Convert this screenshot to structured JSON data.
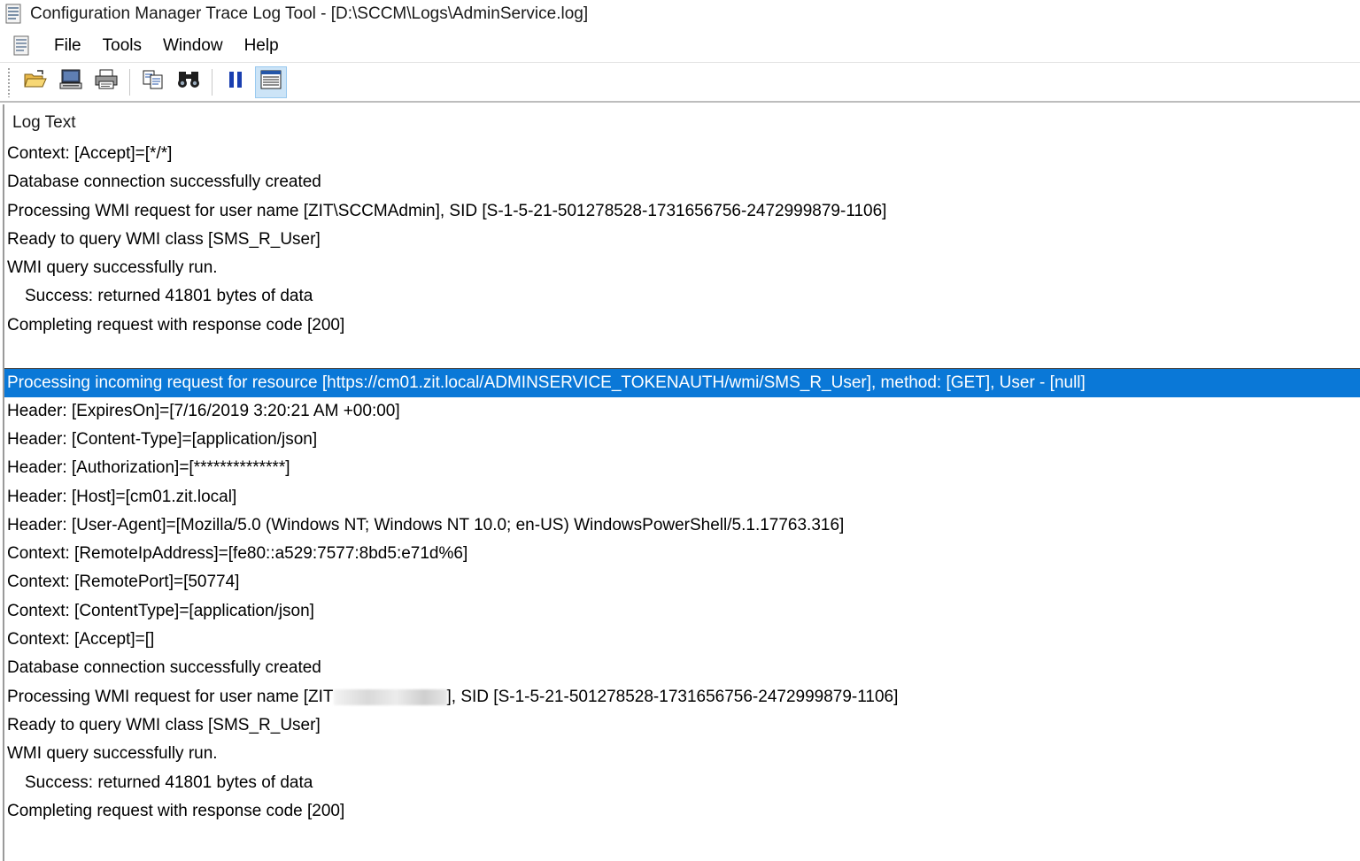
{
  "window": {
    "title": "Configuration Manager Trace Log Tool - [D:\\SCCM\\Logs\\AdminService.log]",
    "app_icon": "log-document-icon"
  },
  "menu": {
    "doc_icon": "document-icon",
    "items": [
      {
        "label": "File"
      },
      {
        "label": "Tools"
      },
      {
        "label": "Window"
      },
      {
        "label": "Help"
      }
    ]
  },
  "toolbar": {
    "buttons": [
      {
        "icon": "open-folder-icon"
      },
      {
        "icon": "computer-icon"
      },
      {
        "icon": "print-icon"
      },
      {
        "icon": "copy-icon"
      },
      {
        "icon": "find-binoculars-icon"
      },
      {
        "icon": "pause-icon"
      },
      {
        "icon": "details-pane-icon",
        "active": true
      }
    ]
  },
  "log": {
    "column_header": "Log Text",
    "selected_color": "#0a78d7",
    "rows": [
      {
        "text": "Context: [Accept]=[*/*]"
      },
      {
        "text": "Database connection successfully created"
      },
      {
        "text": "Processing WMI request for user name [ZIT\\SCCMAdmin], SID [S-1-5-21-501278528-1731656756-2472999879-1106]"
      },
      {
        "text": "Ready to query WMI class [SMS_R_User]"
      },
      {
        "text": "WMI query successfully run."
      },
      {
        "text": "Success: returned 41801 bytes of data"
      },
      {
        "text": "Completing request with response code [200]"
      },
      {
        "text": ""
      },
      {
        "text": "Processing incoming request for resource [https://cm01.zit.local/ADMINSERVICE_TOKENAUTH/wmi/SMS_R_User], method: [GET], User - [null]"
      },
      {
        "text": "Header: [ExpiresOn]=[7/16/2019 3:20:21 AM +00:00]"
      },
      {
        "text": "Header: [Content-Type]=[application/json]"
      },
      {
        "text": "Header: [Authorization]=[**************]"
      },
      {
        "text": "Header: [Host]=[cm01.zit.local]"
      },
      {
        "text": "Header: [User-Agent]=[Mozilla/5.0 (Windows NT; Windows NT 10.0; en-US) WindowsPowerShell/5.1.17763.316]"
      },
      {
        "text": "Context: [RemoteIpAddress]=[fe80::a529:7577:8bd5:e71d%6]"
      },
      {
        "text": "Context: [RemotePort]=[50774]"
      },
      {
        "text": "Context: [ContentType]=[application/json]"
      },
      {
        "text": "Context: [Accept]=[]"
      },
      {
        "text": "Database connection successfully created"
      },
      {
        "text_before": "Processing WMI request for user name [ZIT",
        "text_after": "], SID [S-1-5-21-501278528-1731656756-2472999879-1106]"
      },
      {
        "text": "Ready to query WMI class [SMS_R_User]"
      },
      {
        "text": "WMI query successfully run."
      },
      {
        "text": "Success: returned 41801 bytes of data"
      },
      {
        "text": "Completing request with response code [200]"
      }
    ]
  }
}
